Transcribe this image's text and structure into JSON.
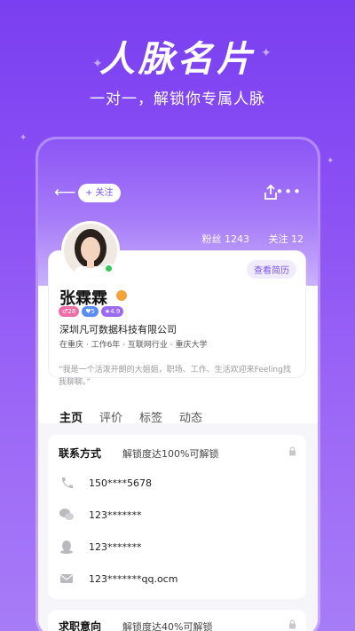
{
  "promo": {
    "headline": "人脉名片",
    "subline": "一对一，解锁你专属人脉"
  },
  "nav": {
    "follow_label": "+ 关注"
  },
  "stats": {
    "fans": "粉丝 1243",
    "following": "关注 12"
  },
  "profile": {
    "resume_label": "查看简历",
    "name": "张霖霖",
    "badges": [
      {
        "label": "♂28",
        "color": "#f06ca7"
      },
      {
        "label": "♥5",
        "color": "#5a8cf5"
      },
      {
        "label": "★4.9",
        "color": "#9b6af0"
      }
    ],
    "company": "深圳凡可数据科技有限公司",
    "meta": "在重庆 · 工作6年 · 互联网行业 · 重庆大学",
    "bio": "“我是一个活泼开朗的大姐姐，职场、工作、生活欢迎来Feeling找我聊聊。”"
  },
  "tabs": [
    "主页",
    "评价",
    "标签",
    "动态"
  ],
  "contact": {
    "title": "联系方式",
    "hint": "解锁度达100%可解锁",
    "rows": [
      {
        "icon": "phone-icon",
        "value": "150****5678"
      },
      {
        "icon": "wechat-icon",
        "value": "123*******"
      },
      {
        "icon": "qq-icon",
        "value": "123*******"
      },
      {
        "icon": "mail-icon",
        "value": "123*******qq.ocm"
      }
    ]
  },
  "job": {
    "title": "求职意向",
    "hint": "解锁度达40%可解锁"
  },
  "colors": {
    "accent": "#7a52ea",
    "background_top": "#7a3ff0"
  }
}
